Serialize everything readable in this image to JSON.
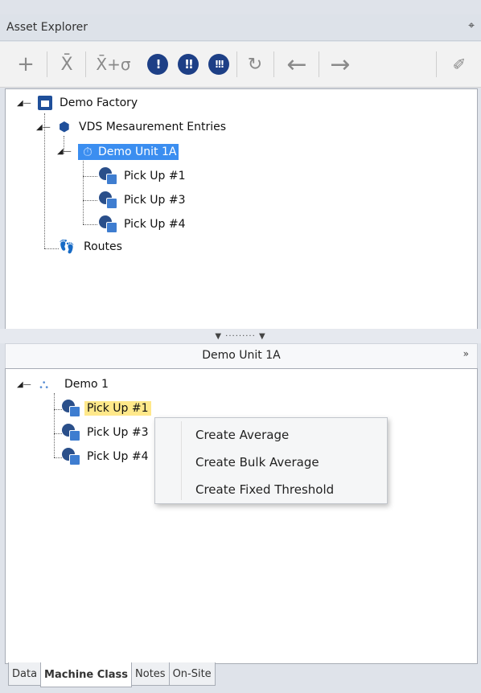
{
  "window": {
    "title": "Asset Explorer",
    "pin_glyph": "⌖"
  },
  "toolbar": {
    "icons": [
      {
        "name": "add-icon",
        "glyph": "+"
      },
      {
        "name": "mean-filter-icon",
        "glyph": "X̄"
      },
      {
        "name": "mean-plus-sigma-icon",
        "glyph": "X̄+σ"
      },
      {
        "name": "alert-1-icon",
        "glyph": "!"
      },
      {
        "name": "alert-2-icon",
        "glyph": "!!"
      },
      {
        "name": "alert-3-icon",
        "glyph": "!!!"
      },
      {
        "name": "refresh-icon",
        "glyph": "↻"
      },
      {
        "name": "back-arrow-icon",
        "glyph": "←"
      },
      {
        "name": "forward-arrow-icon",
        "glyph": "→"
      },
      {
        "name": "clear-brush-icon",
        "glyph": "✐"
      }
    ]
  },
  "upper_tree": {
    "root": "Demo Factory",
    "vds": "VDS Mesaurement Entries",
    "unit": "Demo Unit 1A",
    "pickups": [
      "Pick Up #1",
      "Pick Up #3",
      "Pick Up #4"
    ],
    "routes": "Routes"
  },
  "lower_panel": {
    "title": "Demo Unit 1A",
    "collapse_glyph": "»",
    "root": "Demo 1",
    "pickups": [
      "Pick Up #1",
      "Pick Up #3",
      "Pick Up #4"
    ]
  },
  "context_menu": {
    "items": [
      "Create Average",
      "Create Bulk Average",
      "Create Fixed Threshold"
    ]
  },
  "tabs": [
    {
      "label": "Data",
      "active": false
    },
    {
      "label": "Machine Class",
      "active": true
    },
    {
      "label": "Notes",
      "active": false
    },
    {
      "label": "On-Site",
      "active": false
    }
  ],
  "colors": {
    "selection": "#3b8ef0",
    "highlight": "#ffe88a",
    "icon_blue": "#1d3f86"
  }
}
